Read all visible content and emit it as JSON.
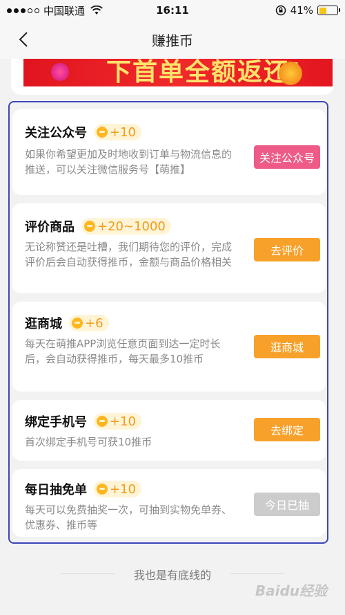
{
  "status_bar": {
    "carrier": "中国联通",
    "time": "16:11",
    "battery": "41%",
    "battery_level": 0.41
  },
  "nav": {
    "title": "赚推币"
  },
  "banner": {
    "text": "下首单全额返还!"
  },
  "tasks": [
    {
      "title": "关注公众号",
      "reward": "+10",
      "desc": "如果你希望更加及时地收到订单与物流信息的推送，可以关注微信服务号【萌推】",
      "button": "关注公众号",
      "button_color": "#ee5b86"
    },
    {
      "title": "评价商品",
      "reward": "+20~1000",
      "desc": "无论称赞还是吐槽，我们期待您的评价，完成评价后会自动获得推币，金额与商品价格相关",
      "button": "去评价",
      "button_color": "#f8a12a"
    },
    {
      "title": "逛商城",
      "reward": "+6",
      "desc": "每天在萌推APP浏览任意页面到达一定时长后，会自动获得推币，每天最多10推币",
      "button": "逛商城",
      "button_color": "#f8a12a"
    },
    {
      "title": "绑定手机号",
      "reward": "+10",
      "desc": "首次绑定手机号可获10推币",
      "button": "去绑定",
      "button_color": "#f8a12a"
    },
    {
      "title": "每日抽免单",
      "reward": "+10",
      "desc": "每天可以免费抽奖一次，可抽到实物免单券、优惠券、推币等",
      "button": "今日已抽",
      "button_color": "#cccccc"
    }
  ],
  "footer": {
    "text": "我也是有底线的"
  },
  "watermark": {
    "text": "Baidu经验"
  },
  "colors": {
    "accent_orange": "#f8a12a",
    "accent_pink": "#ee5b86",
    "disabled_gray": "#cccccc",
    "highlight_border": "#3b45b8"
  }
}
